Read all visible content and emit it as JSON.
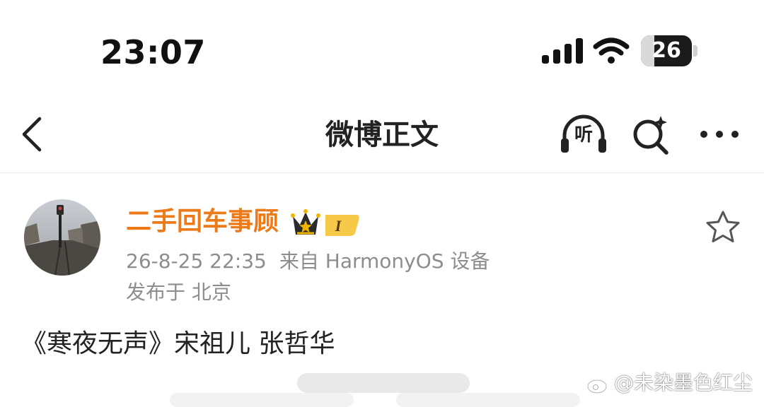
{
  "status_bar": {
    "time": "23:07",
    "battery_level": "26",
    "battery_fraction": 0.26
  },
  "nav": {
    "title": "微博正文",
    "listen_label": "听"
  },
  "post": {
    "username": "二手回车事顾",
    "badge_label": "I",
    "datetime": "26-8-25 22:35",
    "source": "来自 HarmonyOS 设备",
    "location": "发布于 北京",
    "content": "《寒夜无声》宋祖儿 张哲华"
  },
  "watermark": {
    "text": "@未染墨色红尘"
  },
  "colors": {
    "username": "#ec7a18",
    "meta": "#8d8d8d",
    "crown": "#f1b400"
  },
  "icons": {
    "back": "chevron-left-icon",
    "listen": "headphones-icon",
    "search": "search-icon",
    "more": "more-dots-icon",
    "favorite": "star-outline-icon",
    "badge": "crown-icon"
  }
}
